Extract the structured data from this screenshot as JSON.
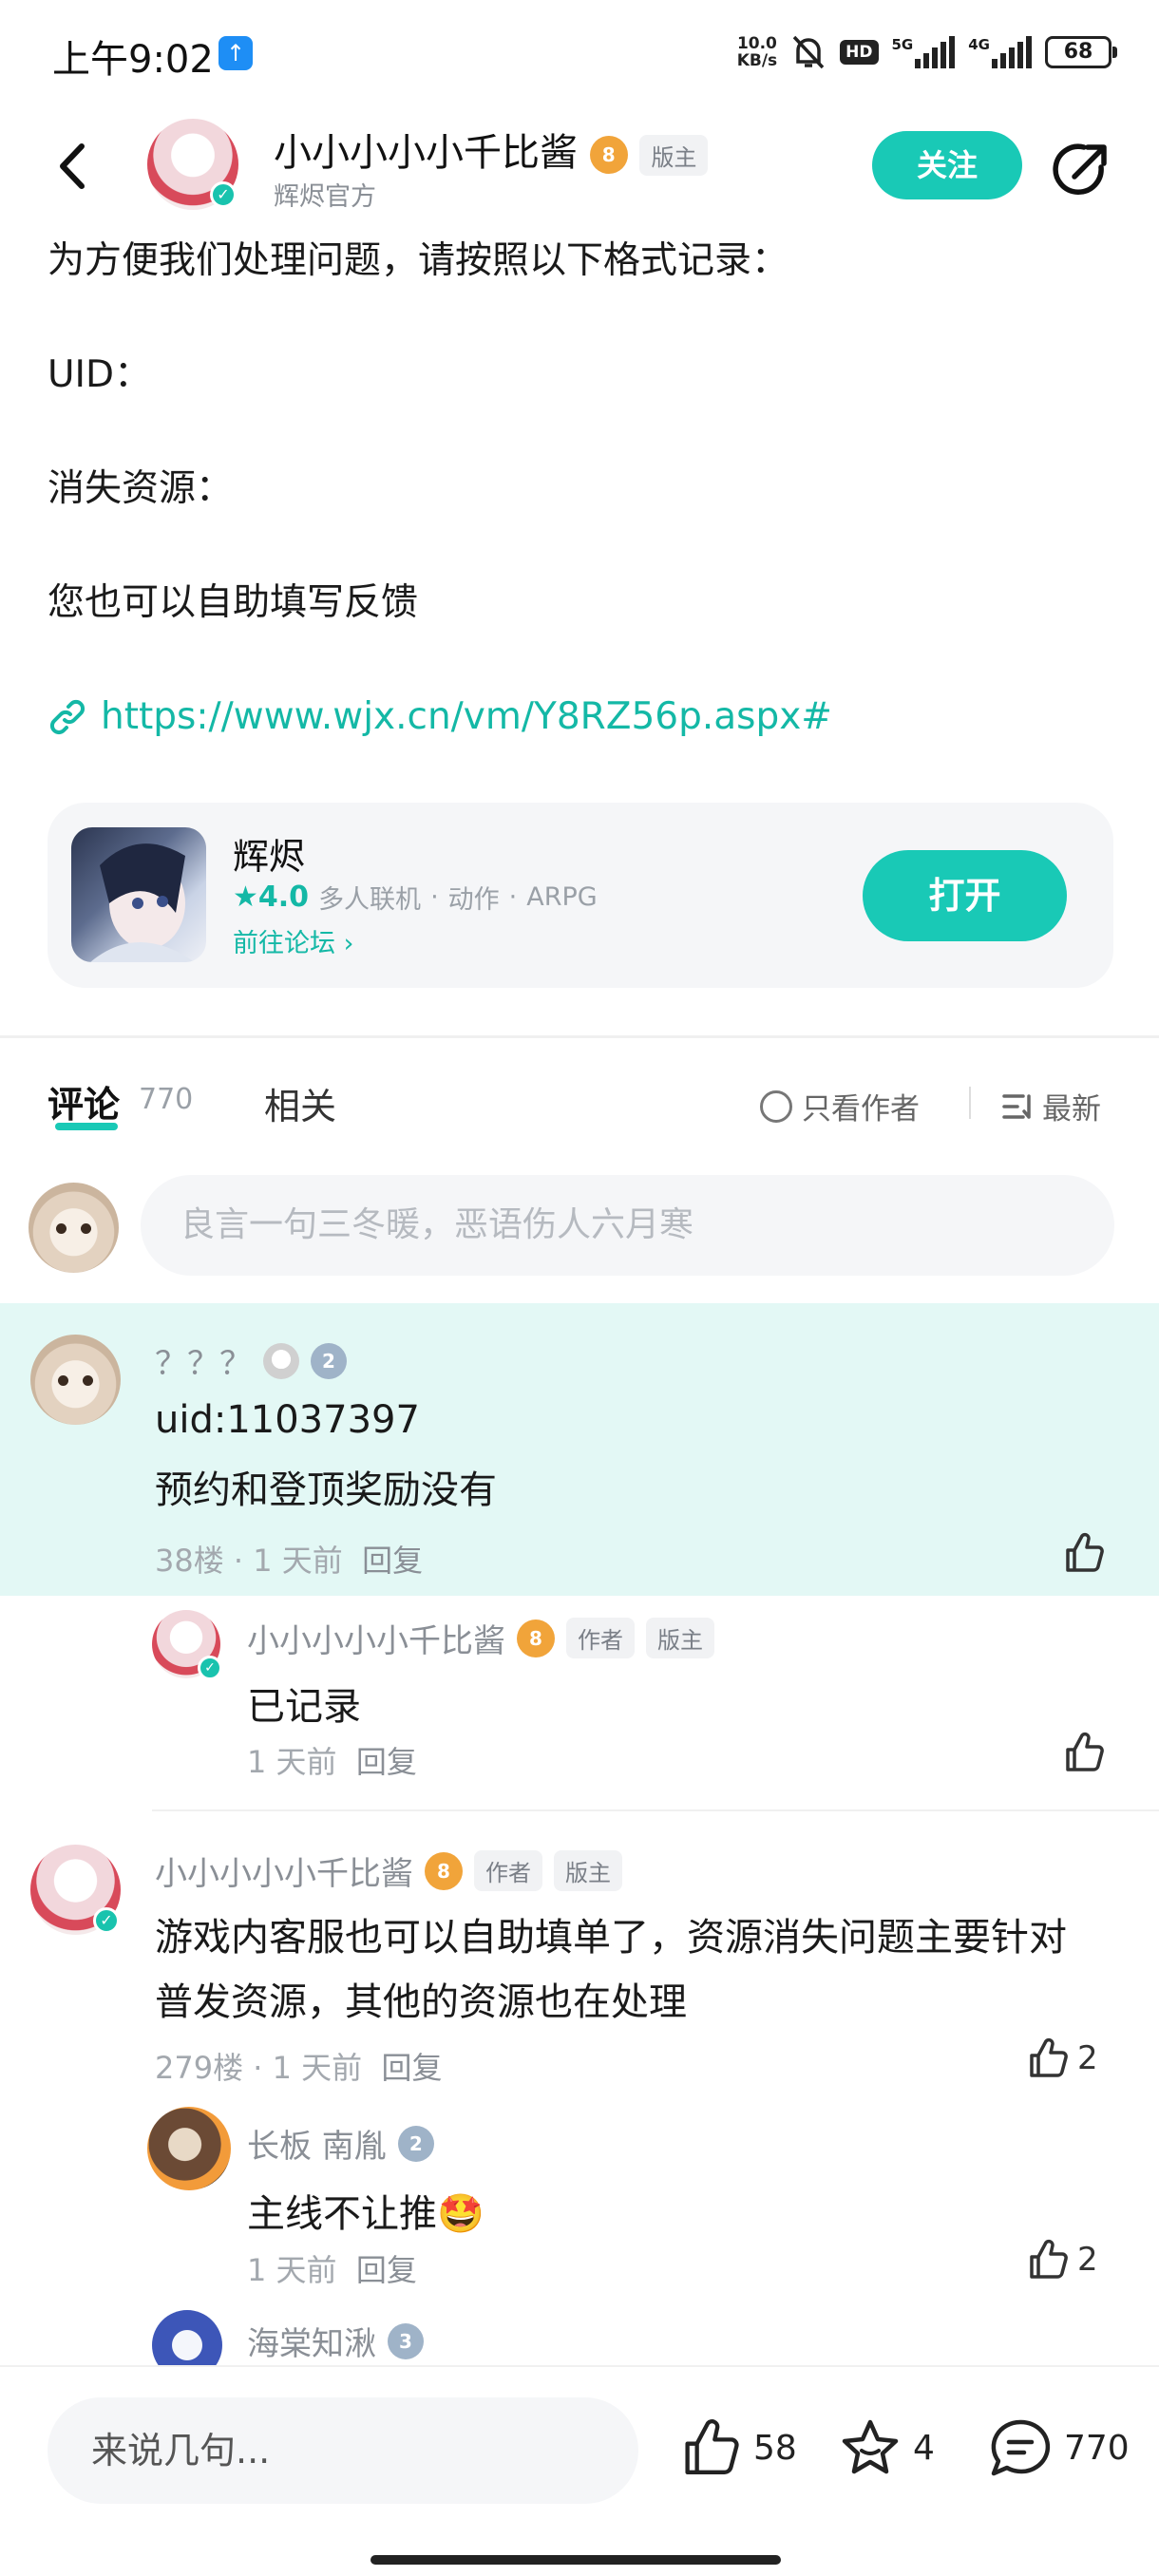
{
  "status_bar": {
    "time": "上午9:02",
    "net_speed_value": "10.0",
    "net_speed_unit": "KB/s",
    "hd_label": "HD",
    "sig1_label": "5G",
    "sig2_label": "4G",
    "battery": "68"
  },
  "header": {
    "author_name": "小小小小小千比酱",
    "author_level": "8",
    "moderator_tag": "版主",
    "author_subtitle": "辉烬官方",
    "follow_label": "关注"
  },
  "post": {
    "lines": [
      "为方便我们处理问题，请按照以下格式记录：",
      "UID：",
      "消失资源：",
      "您也可以自助填写反馈"
    ],
    "link": "https://www.wjx.cn/vm/Y8RZ56p.aspx#"
  },
  "app_card": {
    "name": "辉烬",
    "rating": "4.0",
    "tags": [
      "多人联机",
      "动作",
      "ARPG"
    ],
    "separator": "·",
    "forum_link": "前往论坛",
    "open_label": "打开"
  },
  "tabs": {
    "comments_label": "评论",
    "comments_count": "770",
    "related_label": "相关",
    "author_only_label": "只看作者",
    "sort_label": "最新"
  },
  "comment_input_placeholder": "良言一句三冬暖，恶语伤人六月寒",
  "comments": [
    {
      "name": "？？？",
      "level": "2",
      "lines": [
        "uid:11037397",
        "预约和登顶奖励没有"
      ],
      "floor": "38楼",
      "time": "1 天前",
      "reply": "回复",
      "likes": ""
    },
    {
      "name": "小小小小小千比酱",
      "level": "8",
      "author_tag": "作者",
      "mod_tag": "版主",
      "lines": [
        "已记录"
      ],
      "time": "1 天前",
      "reply": "回复",
      "likes": ""
    },
    {
      "name": "小小小小小千比酱",
      "level": "8",
      "author_tag": "作者",
      "mod_tag": "版主",
      "lines": [
        "游戏内客服也可以自助填单了，资源消失问题主要针对",
        "普发资源，其他的资源也在处理"
      ],
      "floor": "279楼",
      "time": "1 天前",
      "reply": "回复",
      "likes": "2"
    },
    {
      "name": "长板 南胤",
      "level": "2",
      "lines": [
        "主线不让推🤩"
      ],
      "time": "1 天前",
      "reply": "回复",
      "likes": "2"
    },
    {
      "name": "海棠知湫",
      "level": "3"
    }
  ],
  "meta_separator": "·",
  "bottom_bar": {
    "input_placeholder": "来说几句...",
    "likes": "58",
    "favorites": "4",
    "comments": "770"
  },
  "colors": {
    "accent": "#19c9b6",
    "link": "#14b8a6",
    "highlight_bg": "#e3f8f5"
  }
}
